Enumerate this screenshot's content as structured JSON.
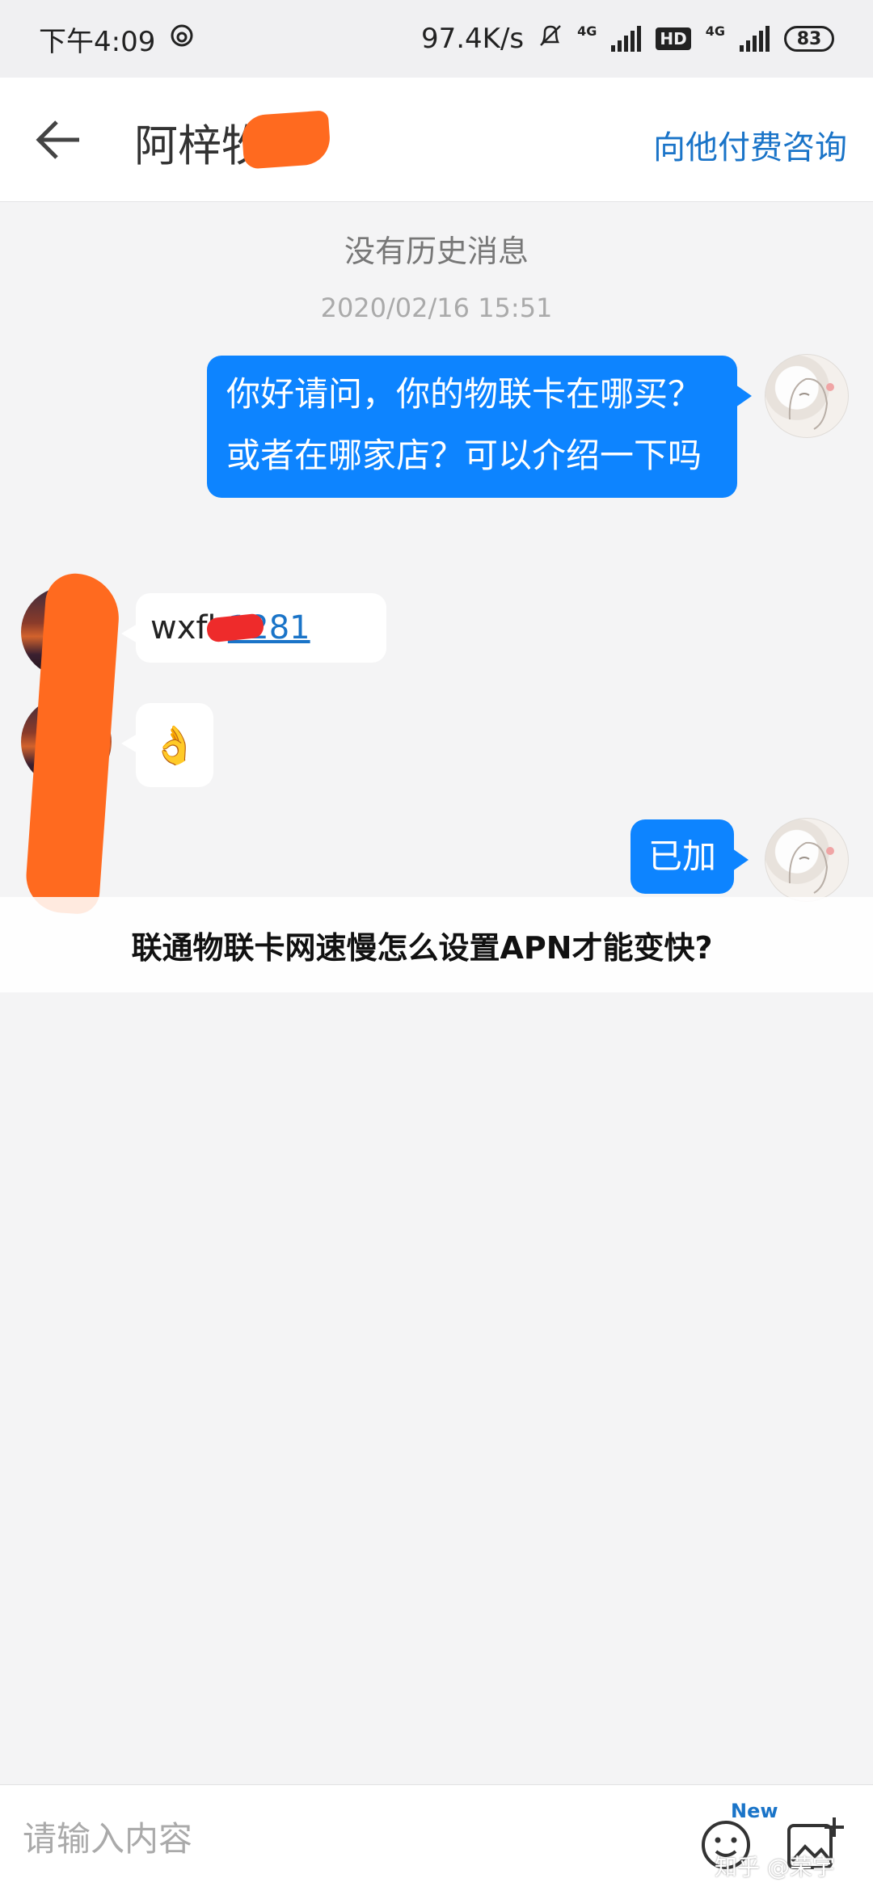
{
  "status_bar": {
    "time": "下午4:09",
    "net_speed": "97.4K/s",
    "network_1": "4G",
    "hd": "HD",
    "network_2": "4G",
    "battery": "83"
  },
  "header": {
    "title": "阿梓牧",
    "pay_consult": "向他付费咨询"
  },
  "chat": {
    "no_history": "没有历史消息",
    "timestamp": "2020/02/16 15:51",
    "messages": [
      {
        "side": "out",
        "text": "你好请问，你的物联卡在哪买？或者在哪家店？可以介绍一下吗"
      },
      {
        "side": "in",
        "text_prefix": "wxfh",
        "link_text": "1281"
      },
      {
        "side": "in",
        "emoji": "👌"
      },
      {
        "side": "out",
        "text": "已加"
      }
    ]
  },
  "caption": "联通物联卡网速慢怎么设置APN才能变快?",
  "input": {
    "placeholder": "请输入内容",
    "new_badge": "New"
  },
  "watermark": "知乎 @荣宇",
  "colors": {
    "accent": "#0d84ff",
    "link": "#1a74c8",
    "redact_orange": "#ff6a1f",
    "redact_red": "#ee2b2b"
  }
}
